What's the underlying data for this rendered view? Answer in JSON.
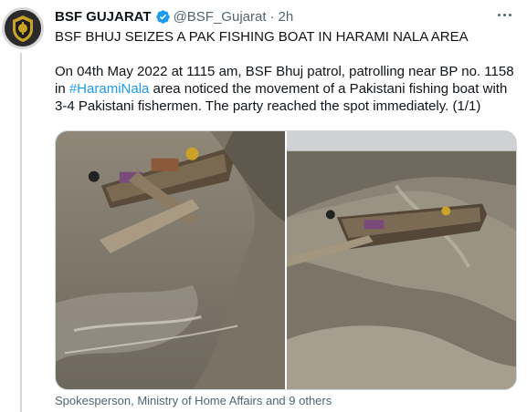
{
  "tweet": {
    "author_name": "BSF GUJARAT",
    "author_handle": "@BSF_Gujarat",
    "separator": "·",
    "time_ago": "2h",
    "headline": "BSF BHUJ SEIZES A PAK FISHING BOAT IN HARAMI NALA AREA",
    "body_before_hashtag": "On 04th May 2022 at 1115 am, BSF Bhuj patrol, patrolling near BP no. 1158 in  ",
    "hashtag": "#HaramiNala",
    "body_after_hashtag": " area noticed the movement of a Pakistani fishing boat with 3-4 Pakistani fishermen. The party reached the spot immediately. (1/1)",
    "liked_by": "Spokesperson, Ministry of Home Affairs and 9 others"
  },
  "icons": {
    "verified": "verified-badge-icon",
    "more": "more-options-icon",
    "avatar": "bsf-emblem-avatar"
  },
  "colors": {
    "link": "#1d9bf0",
    "verified": "#1d9bf0",
    "secondary_text": "#536471"
  }
}
